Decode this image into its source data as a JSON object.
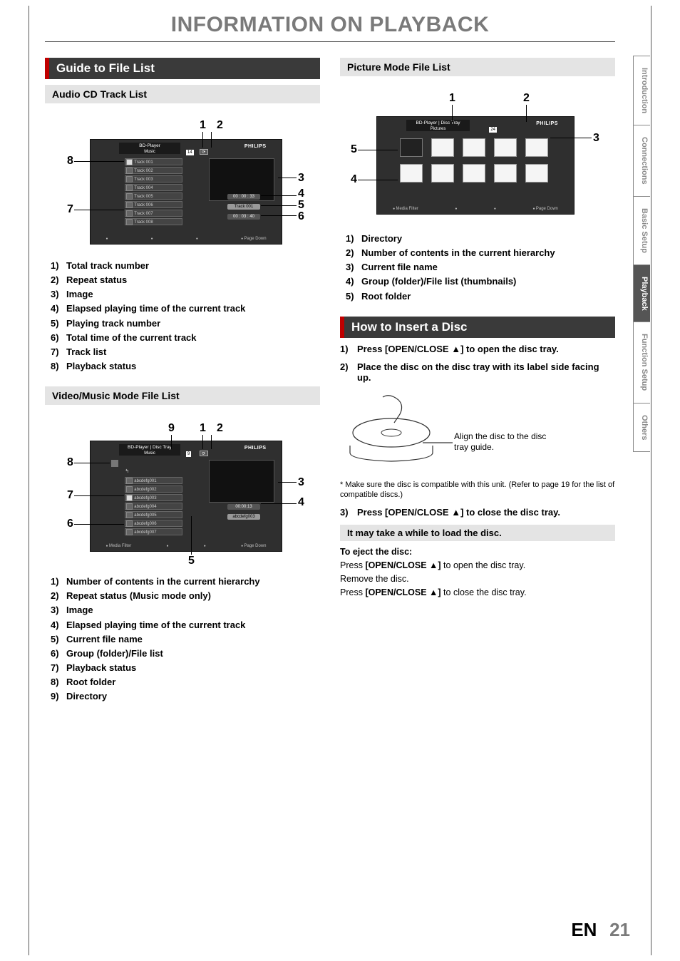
{
  "page_title": "INFORMATION ON PLAYBACK",
  "footer": {
    "lang": "EN",
    "page": "21"
  },
  "side_tabs": {
    "items": [
      {
        "label": "Introduction",
        "active": false
      },
      {
        "label": "Connections",
        "active": false
      },
      {
        "label": "Basic Setup",
        "active": false
      },
      {
        "label": "Playback",
        "active": true
      },
      {
        "label": "Function Setup",
        "active": false
      },
      {
        "label": "Others",
        "active": false
      }
    ]
  },
  "left": {
    "section_title": "Guide to File List",
    "audio": {
      "subtitle": "Audio CD Track List",
      "screen": {
        "header_line1": "BD-Player",
        "header_line2": "Music",
        "brand": "PHILIPS",
        "count": "14",
        "repeat": "⟳",
        "tracks": [
          "Track  001",
          "Track  002",
          "Track  003",
          "Track  004",
          "Track  005",
          "Track  006",
          "Track  007",
          "Track  008"
        ],
        "elapsed": "00 : 00 : 33",
        "playing": "Track 001",
        "total": "00 : 03 : 40",
        "footer_left": "",
        "footer_right": "Page Down"
      },
      "legend": [
        "Total track number",
        "Repeat status",
        "Image",
        "Elapsed playing time of the current track",
        "Playing track number",
        "Total time of the current track",
        "Track list",
        "Playback status"
      ]
    },
    "video": {
      "subtitle": "Video/Music Mode File List",
      "screen": {
        "header_line1": "BD-Player | Disc Tray",
        "header_line2": "Music",
        "brand": "PHILIPS",
        "count": "9",
        "repeat": "⟳",
        "root_icon": "📁",
        "dir_icon": "↰",
        "files": [
          "abcdefg001",
          "abcdefg002",
          "abcdefg003",
          "abcdefg004",
          "abcdefg005",
          "abcdefg006",
          "abcdefg007"
        ],
        "elapsed": "00:00:13",
        "playing": "abcdefg003",
        "footer_left": "Media Filter",
        "footer_right": "Page Down"
      },
      "legend": [
        "Number of contents in the current hierarchy",
        "Repeat status (Music mode only)",
        "Image",
        "Elapsed playing time of the current track",
        "Current file name",
        "Group (folder)/File list",
        "Playback status",
        "Root folder",
        "Directory"
      ]
    }
  },
  "right": {
    "picture": {
      "subtitle": "Picture Mode File List",
      "screen": {
        "header_line1": "BD-Player | Disc Tray",
        "header_line2": "Pictures",
        "brand": "PHILIPS",
        "count": "24",
        "footer_left": "Media Filter",
        "footer_right": "Page Down"
      },
      "legend": [
        "Directory",
        "Number of contents in the current  hierarchy",
        "Current file name",
        "Group (folder)/File list (thumbnails)",
        "Root folder"
      ]
    },
    "insert": {
      "section_title": "How to Insert a Disc",
      "steps": {
        "s1": "Press [OPEN/CLOSE ▲] to open the disc tray.",
        "s2": "Place the disc on the disc tray with its label side facing up.",
        "s3": "Press [OPEN/CLOSE ▲] to close the disc tray."
      },
      "disc_caption": "Align the disc to the disc tray guide.",
      "note": "*  Make sure the disc is compatible with this unit. (Refer to page 19 for the list of compatible discs.)",
      "load_note": "It may take a while to load the disc.",
      "eject": {
        "title": "To eject the disc:",
        "l1a": "Press ",
        "l1b": "[OPEN/CLOSE ▲]",
        "l1c": " to open the disc tray.",
        "l2": "Remove the disc.",
        "l3a": "Press ",
        "l3b": "[OPEN/CLOSE ▲]",
        "l3c": " to close the disc tray."
      }
    }
  }
}
